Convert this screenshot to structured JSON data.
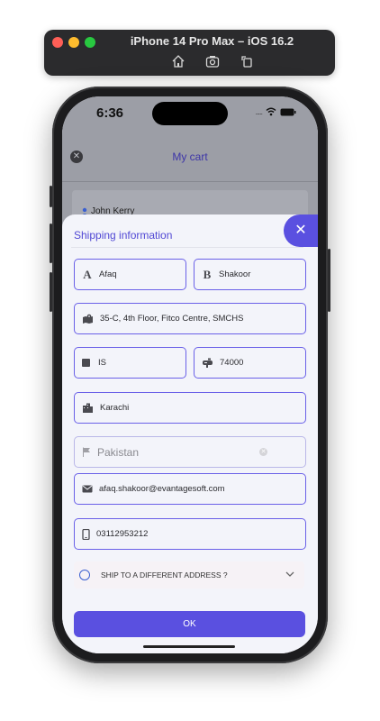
{
  "simulator": {
    "title": "iPhone 14 Pro Max – iOS 16.2",
    "icons": [
      "home-icon",
      "screenshot-icon",
      "rotate-icon"
    ]
  },
  "status_bar": {
    "time": "6:36",
    "signal": "....."
  },
  "cart": {
    "title": "My cart",
    "user_name": "John Kerry"
  },
  "modal": {
    "title": "Shipping information",
    "first_name": "Afaq",
    "last_name": "Shakoor",
    "address": "35-C, 4th Floor, Fitco Centre, SMCHS",
    "state": "IS",
    "postcode": "74000",
    "city": "Karachi",
    "country": "Pakistan",
    "email": "afaq.shakoor@evantagesoft.com",
    "phone": "03112953212",
    "ship_different_label": "SHIP TO A DIFFERENT ADDRESS ?",
    "ok_label": "OK"
  },
  "colors": {
    "accent": "#5a50e0",
    "field_border": "#6a60e8",
    "title": "#5148d4"
  }
}
